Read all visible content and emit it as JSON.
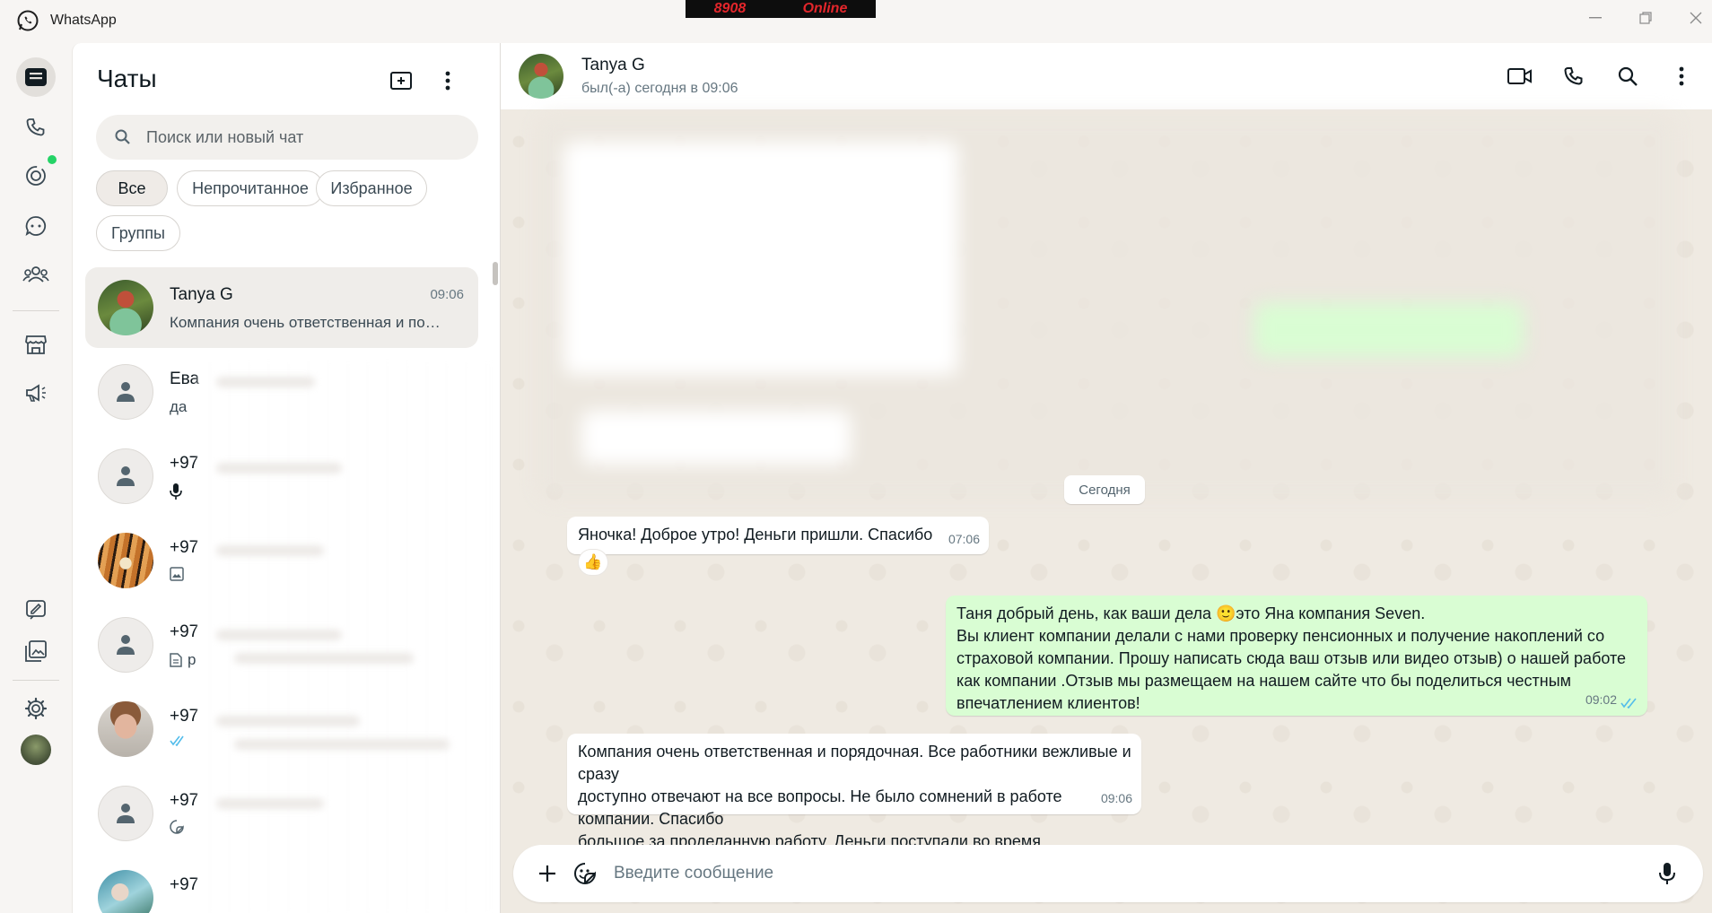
{
  "titlebar": {
    "title": "WhatsApp",
    "badge_left": "8908",
    "badge_right": "Online"
  },
  "chatlist": {
    "title": "Чаты",
    "search_placeholder": "Поиск или новый чат",
    "filters": [
      "Все",
      "Непрочитанное",
      "Избранное",
      "Группы"
    ],
    "active_filter": "Все",
    "chats": [
      {
        "name": "Tanya G",
        "time": "09:06",
        "preview": "Компания очень ответственная и по…",
        "avatar": "photo-woman-red-hair",
        "selected": true
      },
      {
        "name": "Ева",
        "time": "",
        "preview": "да",
        "avatar": "generic"
      },
      {
        "name": "+97",
        "time": "",
        "preview": "",
        "preview_icon": "mic-icon",
        "avatar": "generic"
      },
      {
        "name": "+97",
        "time": "",
        "preview": "",
        "preview_icon": "image-icon",
        "avatar": "photo-tiger"
      },
      {
        "name": "+97",
        "time": "",
        "preview": "р",
        "preview_icon": "document-icon",
        "avatar": "generic"
      },
      {
        "name": "+97",
        "time": "",
        "preview": "",
        "preview_icon": "double-check-icon",
        "avatar": "photo-woman-elderly"
      },
      {
        "name": "+97",
        "time": "",
        "preview": "",
        "preview_icon": "sticker-icon",
        "avatar": "generic"
      },
      {
        "name": "+97",
        "time": "",
        "preview": "",
        "avatar": "photo-outdoor"
      }
    ]
  },
  "conversation": {
    "contact_name": "Tanya G",
    "status": "был(-а) сегодня в 09:06",
    "date_chip": "Сегодня",
    "messages": [
      {
        "direction": "in",
        "text": "Яночка! Доброе утро! Деньги пришли. Спасибо",
        "time": "07:06",
        "reaction": "👍"
      },
      {
        "direction": "out",
        "lines": [
          "Таня добрый день, как ваши дела 🙂это Яна компания Seven.",
          "Вы клиент компании делали с нами проверку пенсионных и получение накоплений со",
          "страховой компании. Прошу написать сюда ваш отзыв или видео отзыв) о нашей работе",
          "как компании .Отзыв мы размещаем на нашем сайте что бы поделиться честным",
          "впечатлением клиентов!"
        ],
        "time": "09:02",
        "status_icon": "double-check-blue"
      },
      {
        "direction": "in",
        "lines": [
          "Компания очень ответственная и порядочная. Все работники вежливые и сразу",
          "доступно отвечают на все вопросы. Не было сомнений в работе компании. Спасибо",
          "большое за проделанную работу. Деньги поступали во время."
        ],
        "time": "09:06"
      }
    ],
    "composer_placeholder": "Введите сообщение"
  },
  "colors": {
    "accent": "#25d366",
    "outgoing_bubble": "#d9fdd3",
    "chat_bg": "#efeae2",
    "read_tick": "#53bdeb"
  }
}
